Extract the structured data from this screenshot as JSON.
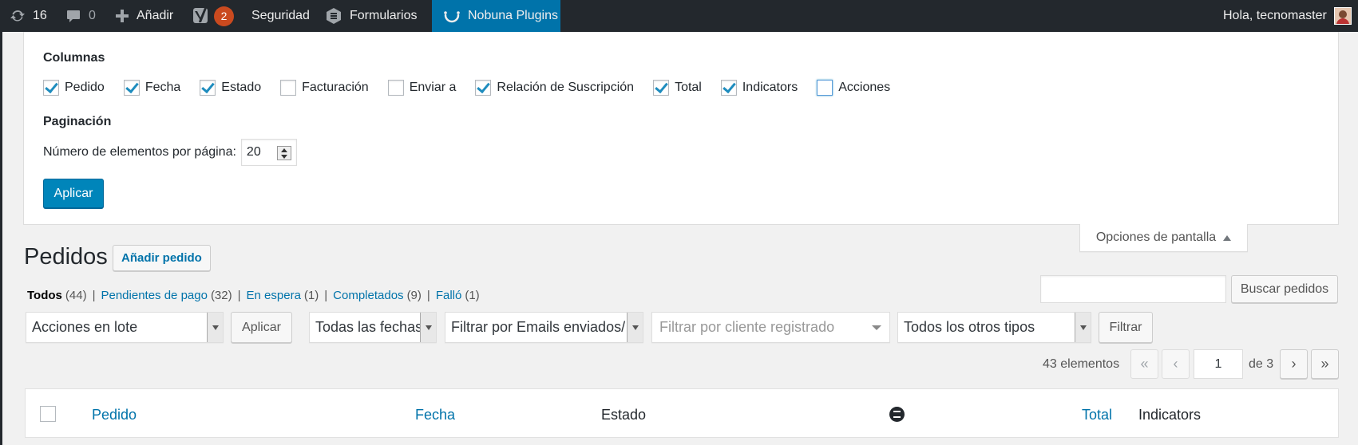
{
  "adminbar": {
    "updates_count": "16",
    "comments_count": "0",
    "new_label": "Añadir",
    "yoast_badge": "2",
    "security_label": "Seguridad",
    "forms_label": "Formularios",
    "nobuna_label": "Nobuna Plugins",
    "greeting": "Hola, tecnomaster"
  },
  "screen_options": {
    "columns_heading": "Columnas",
    "columns": [
      {
        "label": "Pedido",
        "checked": true
      },
      {
        "label": "Fecha",
        "checked": true
      },
      {
        "label": "Estado",
        "checked": true
      },
      {
        "label": "Facturación",
        "checked": false
      },
      {
        "label": "Enviar a",
        "checked": false
      },
      {
        "label": "Relación de Suscripción",
        "checked": true
      },
      {
        "label": "Total",
        "checked": true
      },
      {
        "label": "Indicators",
        "checked": true
      },
      {
        "label": "Acciones",
        "checked": false
      }
    ],
    "pagination_heading": "Paginación",
    "per_page_label": "Número de elementos por página:",
    "per_page_value": "20",
    "apply_label": "Aplicar",
    "tab_label": "Opciones de pantalla"
  },
  "page": {
    "title": "Pedidos",
    "add_button": "Añadir pedido",
    "search_placeholder": "",
    "search_button": "Buscar pedidos"
  },
  "status_filters": [
    {
      "label": "Todos",
      "count": "(44)",
      "current": true
    },
    {
      "label": "Pendientes de pago",
      "count": "(32)",
      "current": false
    },
    {
      "label": "En espera",
      "count": "(1)",
      "current": false
    },
    {
      "label": "Completados",
      "count": "(9)",
      "current": false
    },
    {
      "label": "Falló",
      "count": "(1)",
      "current": false
    }
  ],
  "filters": {
    "bulk_actions": "Acciones en lote",
    "bulk_apply": "Aplicar",
    "dates": "Todas las fechas",
    "emails": "Filtrar por Emails enviados/enviado",
    "customer_placeholder": "Filtrar por cliente registrado",
    "types": "Todos los otros tipos",
    "filter_button": "Filtrar"
  },
  "pagination": {
    "displaying": "43 elementos",
    "first": "«",
    "prev": "‹",
    "current_page": "1",
    "of_total": "de 3",
    "next": "›",
    "last": "»"
  },
  "table": {
    "headers": [
      "Pedido",
      "Fecha",
      "Estado",
      "Total",
      "Indicators"
    ]
  },
  "colors": {
    "adminbar_bg": "#23282d",
    "accent": "#0073aa",
    "primary_button": "#0085ba",
    "badge": "#ca4a1f"
  }
}
